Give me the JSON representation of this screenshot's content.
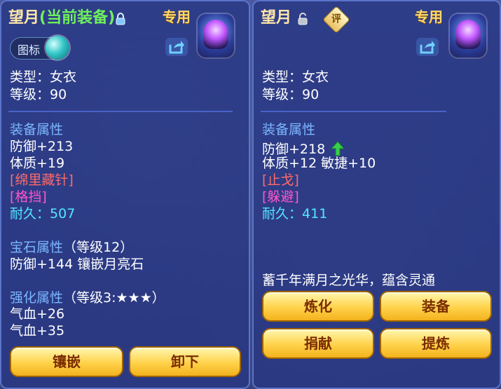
{
  "colors": {
    "panel_bg": "#28378a",
    "panel_border": "#5a74c8",
    "gold_button": "#ffd24a",
    "gold_button_text": "#7b2c00",
    "attribute_label": "#7bb7ff",
    "current_equipment": "#6ff05c",
    "special_red": "#ff6a6a",
    "special_pink": "#ff55cc",
    "durability": "#52e8ff",
    "up_arrow": "#35d04c"
  },
  "left_panel": {
    "title": "望月",
    "current_equipment": "(当前装备)",
    "lock_icon": "lock-closed-icon",
    "exclusive": "专用",
    "toggle_label": "图标",
    "share_icon": "share-icon",
    "type_line": "类型：女衣",
    "level_line": "等级：90",
    "equip_attr_title": "装备属性",
    "stats": {
      "defense": "防御+213",
      "constitution": "体质+19",
      "special_red": "[绵里藏针]",
      "special_pink": "[格挡]",
      "durability_label": "耐久：",
      "durability_value": "507"
    },
    "gem_title": "宝石属性",
    "gem_level": "（等级12）",
    "gem_line": "防御+144 镶嵌月亮石",
    "enhance_title": "强化属性",
    "enhance_level": "（等级3:★★★）",
    "enhance_lines": [
      "气血+26",
      "气血+35"
    ],
    "buttons": {
      "inlay": "镶嵌",
      "unequip": "卸下"
    }
  },
  "right_panel": {
    "title": "望月",
    "lock_icon": "lock-open-icon",
    "comment_icon": "评",
    "exclusive": "专用",
    "share_icon": "share-icon",
    "type_line": "类型：女衣",
    "level_line": "等级：90",
    "equip_attr_title": "装备属性",
    "stats": {
      "defense": "防御+218",
      "constitution_agility": "体质+12 敏捷+10",
      "special_red": "[止戈]",
      "special_pink": "[躲避]",
      "durability_label": "耐久：",
      "durability_value": "411"
    },
    "description": "蓄千年满月之光华，蕴含灵通",
    "buttons": {
      "refine": "炼化",
      "equip": "装备",
      "donate": "捐献",
      "extract": "提炼"
    }
  }
}
